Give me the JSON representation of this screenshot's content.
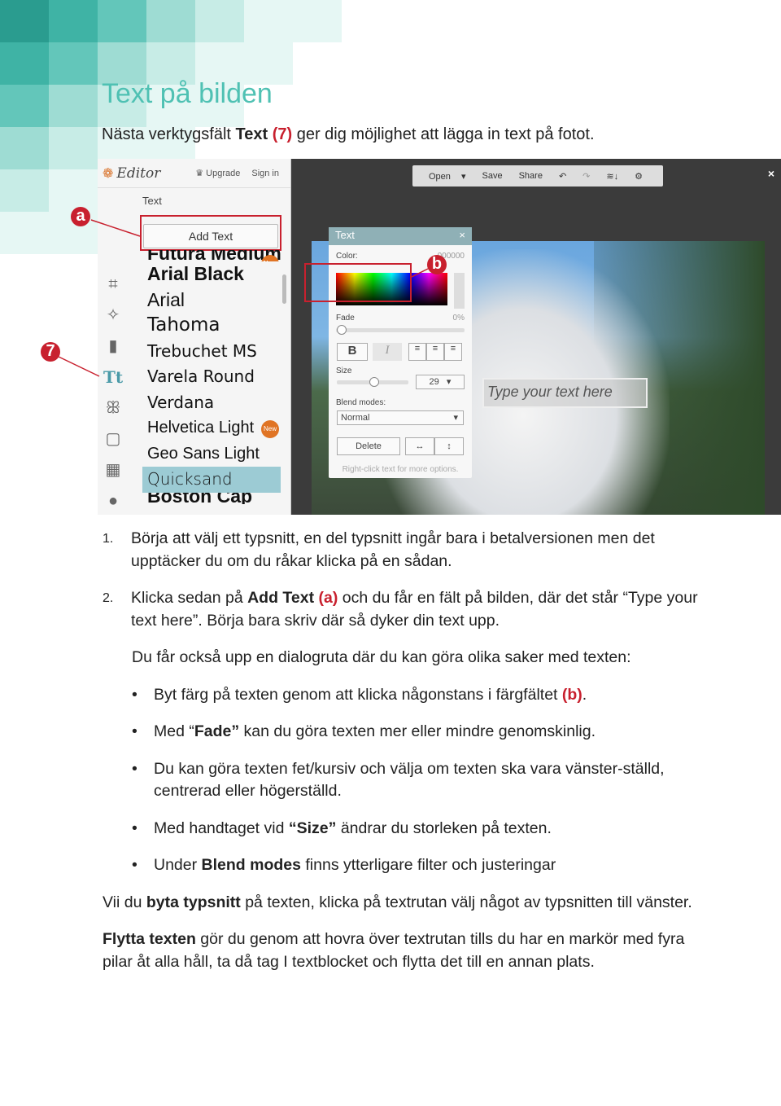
{
  "page": {
    "title": "Text på bilden",
    "intro": {
      "pre": "Nästa verktygsfält ",
      "bold": "Text",
      "ref": " (7)",
      "post": " ger dig möjlighet att lägga in text på fotot."
    }
  },
  "colors": {
    "accent": "#4fc1b3",
    "marker": "#c8202e"
  },
  "callouts": {
    "a": "a",
    "b": "b",
    "seven": "7"
  },
  "editor": {
    "logo": "Editor",
    "upgrade": "Upgrade",
    "signin": "Sign in",
    "panel_title": "Text",
    "add_text": "Add Text",
    "tools": [
      "crop-icon",
      "magic-wand-icon",
      "lipstick-icon",
      "text-icon",
      "butterfly-icon",
      "frame-icon",
      "texture-icon",
      "apple-icon"
    ],
    "text_tool_label": "Tt",
    "fonts": [
      {
        "name": "Futura Medium",
        "new": true
      },
      {
        "name": "Arial Black"
      },
      {
        "name": "Arial"
      },
      {
        "name": "Tahoma"
      },
      {
        "name": "Trebuchet MS"
      },
      {
        "name": "Varela Round"
      },
      {
        "name": "Verdana"
      },
      {
        "name": "Helvetica Light",
        "new": true
      },
      {
        "name": "Geo Sans Light"
      },
      {
        "name": "Quicksand",
        "selected": true
      },
      {
        "name": "Boston Cap"
      }
    ],
    "new_badge": "New",
    "toolbar": {
      "open": "Open",
      "save": "Save",
      "share": "Share"
    },
    "close": "×",
    "canvas_placeholder": "Type your text here",
    "dialog": {
      "title": "Text",
      "close": "×",
      "color_label": "Color:",
      "color_value": "000000",
      "fade_label": "Fade",
      "fade_value": "0%",
      "bold": "B",
      "italic": "I",
      "size_label": "Size",
      "size_value": "29",
      "blend_label": "Blend modes:",
      "blend_value": "Normal",
      "delete": "Delete",
      "flip_h": "↔",
      "flip_v": "↕",
      "hint": "Right-click text for more options."
    }
  },
  "body": {
    "item1": {
      "num": "1.",
      "text": "Börja att välj ett typsnitt, en del typsnitt ingår bara i betalversionen men det upptäcker du om du råkar klicka på en sådan."
    },
    "item2": {
      "num": "2.",
      "pre": "Klicka sedan på ",
      "bold": "Add Text",
      "ref": " (a)",
      "post": " och du får en fält på bilden, där det står “Type your text here”. Börja bara skriv där så dyker din text upp."
    },
    "dialog_intro": "Du får också upp en dialogruta där du kan göra olika saker med texten:",
    "bullets": [
      {
        "pre": "Byt färg på texten genom att klicka någonstans i färgfältet ",
        "ref": "(b)",
        "post": "."
      },
      {
        "pre": "Med “",
        "bold": "Fade”",
        "post": " kan du göra texten mer eller mindre genomskinlig."
      },
      {
        "pre": "Du kan göra texten fet/kursiv och välja om texten ska vara vänster-ställd, centrerad eller högerställd."
      },
      {
        "pre": "Med handtaget vid ",
        "bold": "“Size”",
        "post": " ändrar du storleken på texten."
      },
      {
        "pre": "Under ",
        "bold": "Blend modes",
        "post": " finns ytterligare filter och justeringar"
      }
    ],
    "para1": {
      "pre": "Vii du ",
      "bold": "byta typsnitt",
      "post": " på texten, klicka på textrutan välj något av typsnitten till vänster."
    },
    "para2": {
      "bold": "Flytta texten",
      "post": " gör du genom att hovra över textrutan tills du har en markör med fyra pilar åt alla håll, ta då tag I textblocket och flytta det till en annan plats."
    }
  }
}
